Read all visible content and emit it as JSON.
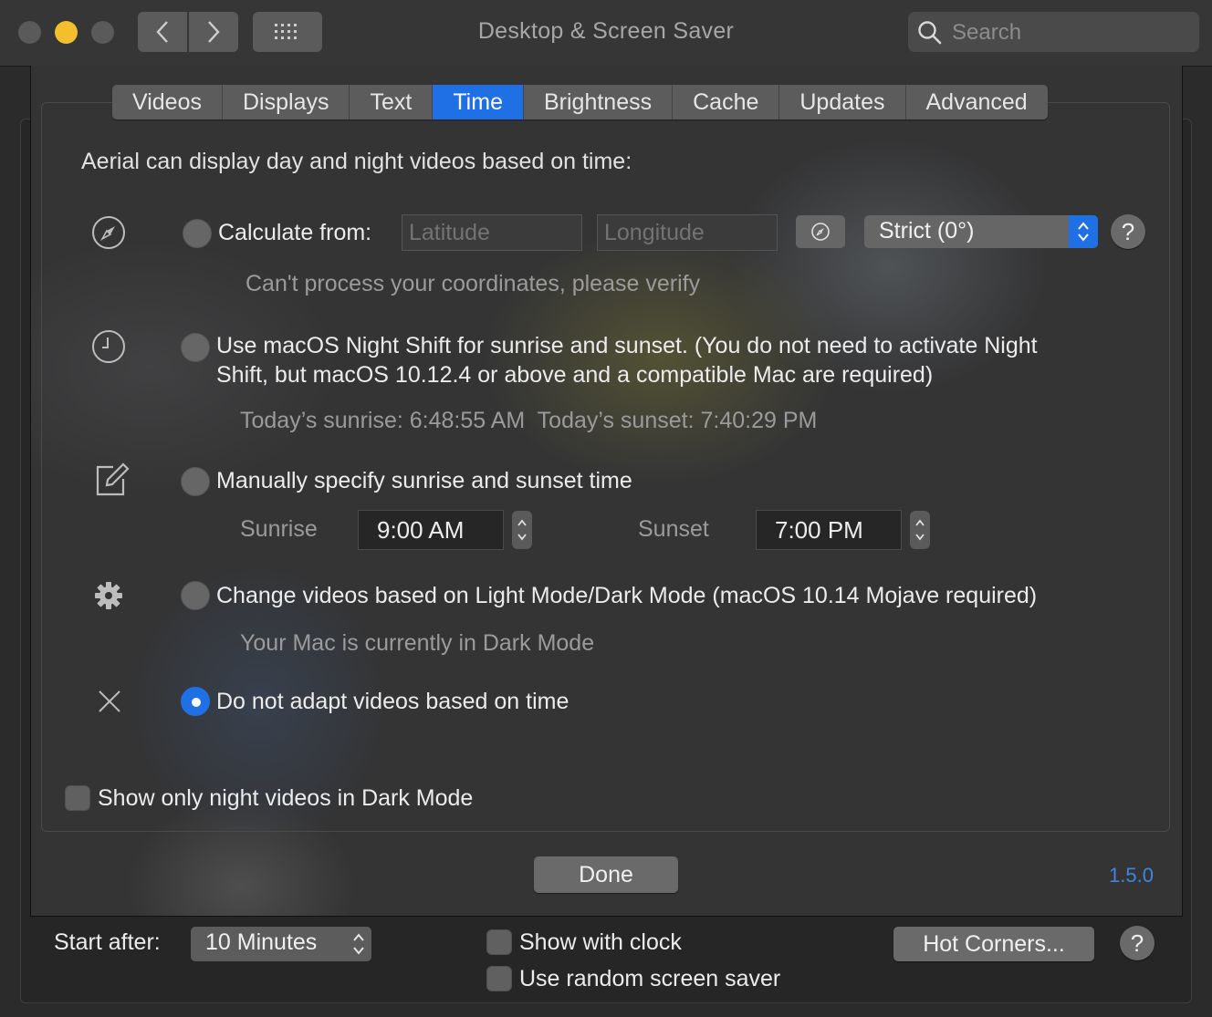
{
  "window": {
    "title": "Desktop & Screen Saver"
  },
  "search": {
    "placeholder": "Search"
  },
  "tabs": [
    {
      "label": "Videos"
    },
    {
      "label": "Displays"
    },
    {
      "label": "Text"
    },
    {
      "label": "Time",
      "active": true
    },
    {
      "label": "Brightness"
    },
    {
      "label": "Cache"
    },
    {
      "label": "Updates"
    },
    {
      "label": "Advanced"
    }
  ],
  "time": {
    "intro": "Aerial can display day and night videos based on time:",
    "calculate": {
      "label": "Calculate from:",
      "latitude_placeholder": "Latitude",
      "longitude_placeholder": "Longitude",
      "mode_value": "Strict (0°)",
      "status": "Can't process your coordinates, please verify",
      "selected": false
    },
    "nightshift": {
      "label_line1": "Use macOS Night Shift for sunrise and sunset. (You do not need to activate Night",
      "label_line2": "Shift, but macOS 10.12.4 or above and a compatible Mac are required)",
      "info": "Today’s sunrise: 6:48:55 AM  Today’s sunset: 7:40:29 PM",
      "selected": false
    },
    "manual": {
      "label": "Manually specify sunrise and sunset time",
      "sunrise_label": "Sunrise",
      "sunrise_value": "9:00 AM",
      "sunset_label": "Sunset",
      "sunset_value": "7:00 PM",
      "selected": false
    },
    "darkmode": {
      "label": "Change videos based on Light Mode/Dark Mode (macOS 10.14 Mojave required)",
      "info": "Your Mac is currently in Dark Mode",
      "selected": false
    },
    "none": {
      "label": "Do not adapt videos based on time",
      "selected": true
    },
    "night_only_checkbox": {
      "label": "Show only night videos in Dark Mode",
      "checked": false
    }
  },
  "sheet": {
    "done_label": "Done",
    "version": "1.5.0"
  },
  "bottom": {
    "start_after_label": "Start after:",
    "start_after_value": "10 Minutes",
    "show_clock_label": "Show with clock",
    "random_saver_label": "Use random screen saver",
    "hot_corners_label": "Hot Corners...",
    "help_label": "?"
  },
  "colors": {
    "accent": "#1f6fe5",
    "background": "#343435"
  }
}
